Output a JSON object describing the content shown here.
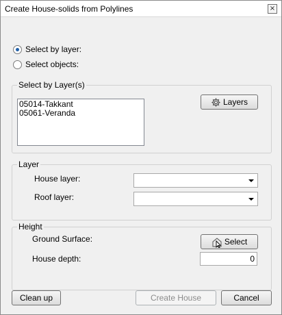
{
  "window": {
    "title": "Create House-solids from Polylines",
    "close_glyph": "×"
  },
  "selection_mode": {
    "by_layer_label": "Select by layer:",
    "by_objects_label": "Select objects:",
    "selected": "by_layer"
  },
  "layer_selection": {
    "group_label": "Select by Layer(s)",
    "items": [
      "05014-Takkant",
      "05061-Veranda"
    ],
    "layers_button": "Layers",
    "layers_icon": "gear-icon"
  },
  "layer": {
    "group_label": "Layer",
    "house_layer_label": "House layer:",
    "house_layer_value": "",
    "roof_layer_label": "Roof layer:",
    "roof_layer_value": ""
  },
  "height": {
    "group_label": "Height",
    "ground_surface_label": "Ground Surface:",
    "select_button": "Select",
    "select_icon": "pick-cursor-icon",
    "house_depth_label": "House depth:",
    "house_depth_value": "0"
  },
  "footer": {
    "clean_up": "Clean up",
    "create_house": "Create House",
    "cancel": "Cancel"
  }
}
